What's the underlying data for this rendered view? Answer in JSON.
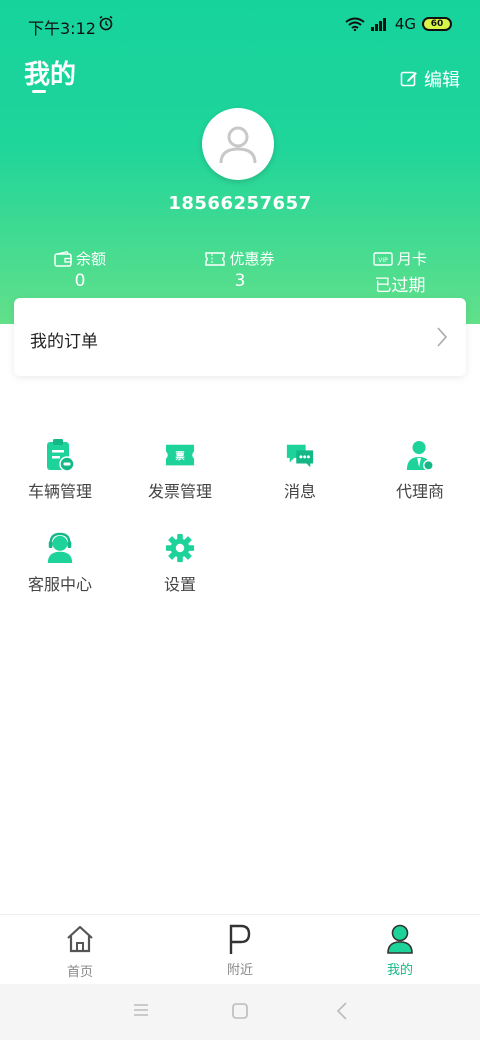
{
  "status_bar": {
    "time": "下午3:12",
    "network": "4G",
    "battery": "60"
  },
  "header": {
    "title": "我的",
    "edit_label": "编辑"
  },
  "profile": {
    "phone": "18566257657"
  },
  "stats": [
    {
      "label": "余额",
      "value": "0"
    },
    {
      "label": "优惠券",
      "value": "3"
    },
    {
      "label": "月卡",
      "value": "已过期"
    }
  ],
  "orders": {
    "label": "我的订单"
  },
  "services": [
    {
      "label": "车辆管理",
      "icon": "vehicle-clipboard-icon"
    },
    {
      "label": "发票管理",
      "icon": "invoice-ticket-icon"
    },
    {
      "label": "消息",
      "icon": "chat-bubbles-icon"
    },
    {
      "label": "代理商",
      "icon": "agent-person-icon"
    },
    {
      "label": "客服中心",
      "icon": "headset-agent-icon"
    },
    {
      "label": "设置",
      "icon": "gear-icon"
    }
  ],
  "tabbar": {
    "items": [
      {
        "label": "首页",
        "icon": "home-icon",
        "active": false
      },
      {
        "label": "附近",
        "icon": "parking-icon",
        "active": false
      },
      {
        "label": "我的",
        "icon": "user-icon",
        "active": true
      }
    ]
  },
  "colors": {
    "accent": "#1dd39a",
    "accent_dark": "#13b886",
    "text": "#333333",
    "tab_inactive": "#888888"
  }
}
